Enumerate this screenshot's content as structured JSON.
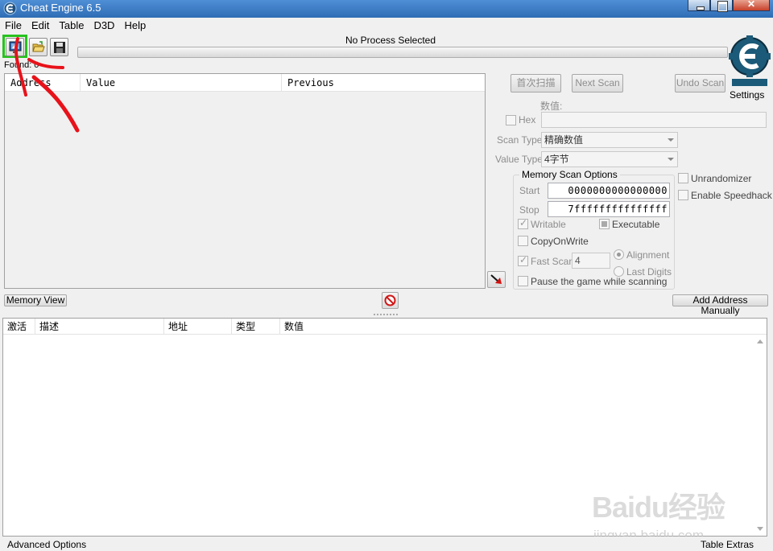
{
  "window": {
    "title": "Cheat Engine 6.5"
  },
  "menu": [
    "File",
    "Edit",
    "Table",
    "D3D",
    "Help"
  ],
  "process": {
    "label": "No Process Selected",
    "progress": 0
  },
  "settings_label": "Settings",
  "found_label": "Found: 0",
  "results_columns": [
    "Address",
    "Value",
    "Previous"
  ],
  "scan": {
    "first_scan": "首次扫描",
    "next_scan": "Next Scan",
    "undo_scan": "Undo Scan",
    "value_label": "数值:",
    "value_input": "",
    "hex_label": "Hex",
    "scan_type_label": "Scan Type",
    "scan_type_value": "精确数值",
    "value_type_label": "Value Type",
    "value_type_value": "4字节"
  },
  "memory_options": {
    "title": "Memory Scan Options",
    "start_label": "Start",
    "start_value": "0000000000000000",
    "stop_label": "Stop",
    "stop_value": "7fffffffffffffff",
    "writable": "Writable",
    "executable": "Executable",
    "copy_on_write": "CopyOnWrite",
    "fast_scan": "Fast Scan",
    "fast_scan_value": "4",
    "alignment": "Alignment",
    "last_digits": "Last Digits",
    "pause_game": "Pause the game while scanning"
  },
  "side_options": {
    "unrandomizer": "Unrandomizer",
    "speedhack": "Enable Speedhack"
  },
  "buttons": {
    "memory_view": "Memory View",
    "add_address": "Add Address Manually"
  },
  "address_columns": [
    "激活",
    "描述",
    "地址",
    "类型",
    "数值"
  ],
  "status": {
    "advanced": "Advanced Options",
    "extras": "Table Extras"
  },
  "watermark": {
    "main": "Baidu经验",
    "sub": "jingyan.baidu.com"
  },
  "colors": {
    "highlight": "#27c21e",
    "annotation": "#e8121a",
    "titlebar": "#3a79b8"
  }
}
